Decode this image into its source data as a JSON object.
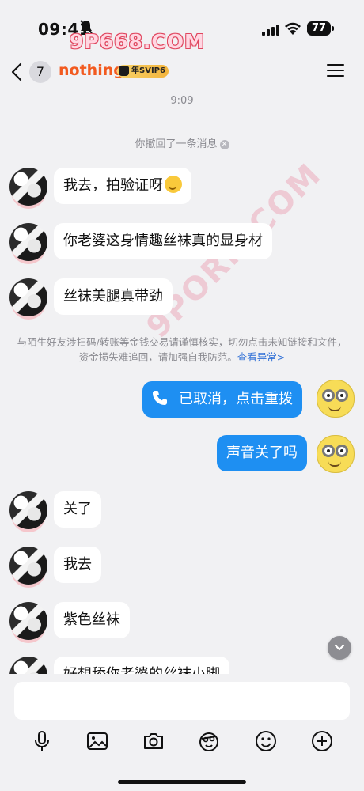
{
  "status_bar": {
    "time": "09:41",
    "battery": "77",
    "watermark": "9P668.COM"
  },
  "header": {
    "unread_count": "7",
    "contact_name": "nothing",
    "vip_label": "年SVIP6"
  },
  "chat": {
    "timestamp": "9:09",
    "recall_notice": "你撤回了一条消息",
    "security_notice": "与陌生好友涉扫码/转账等金钱交易请谨慎核实，切勿点击未知链接和文件，资金损失难追回，请加强自我防范。",
    "security_link": "查看异常>",
    "watermark": "9PORN.COM",
    "messages": [
      {
        "side": "left",
        "text": "我去，拍验证呀"
      },
      {
        "side": "left",
        "text": "你老婆这身情趣丝袜真的显身材"
      },
      {
        "side": "left",
        "text": "丝袜美腿真带劲"
      },
      {
        "side": "right",
        "text": "已取消，点击重拨",
        "kind": "call"
      },
      {
        "side": "right",
        "text": "声音关了吗"
      },
      {
        "side": "left",
        "text": "关了"
      },
      {
        "side": "left",
        "text": "我去"
      },
      {
        "side": "left",
        "text": "紫色丝袜"
      },
      {
        "side": "left",
        "text": "好想舔你老婆的丝袜小脚"
      }
    ]
  },
  "composer": {
    "input_value": "",
    "placeholder": "",
    "tools": [
      "microphone-icon",
      "image-icon",
      "camera-icon",
      "sticker-icon",
      "smiley-icon",
      "plus-icon"
    ]
  },
  "colors": {
    "accent_blue": "#1e8ff2",
    "name_orange": "#f25a1f",
    "background": "#f1f1f3"
  }
}
